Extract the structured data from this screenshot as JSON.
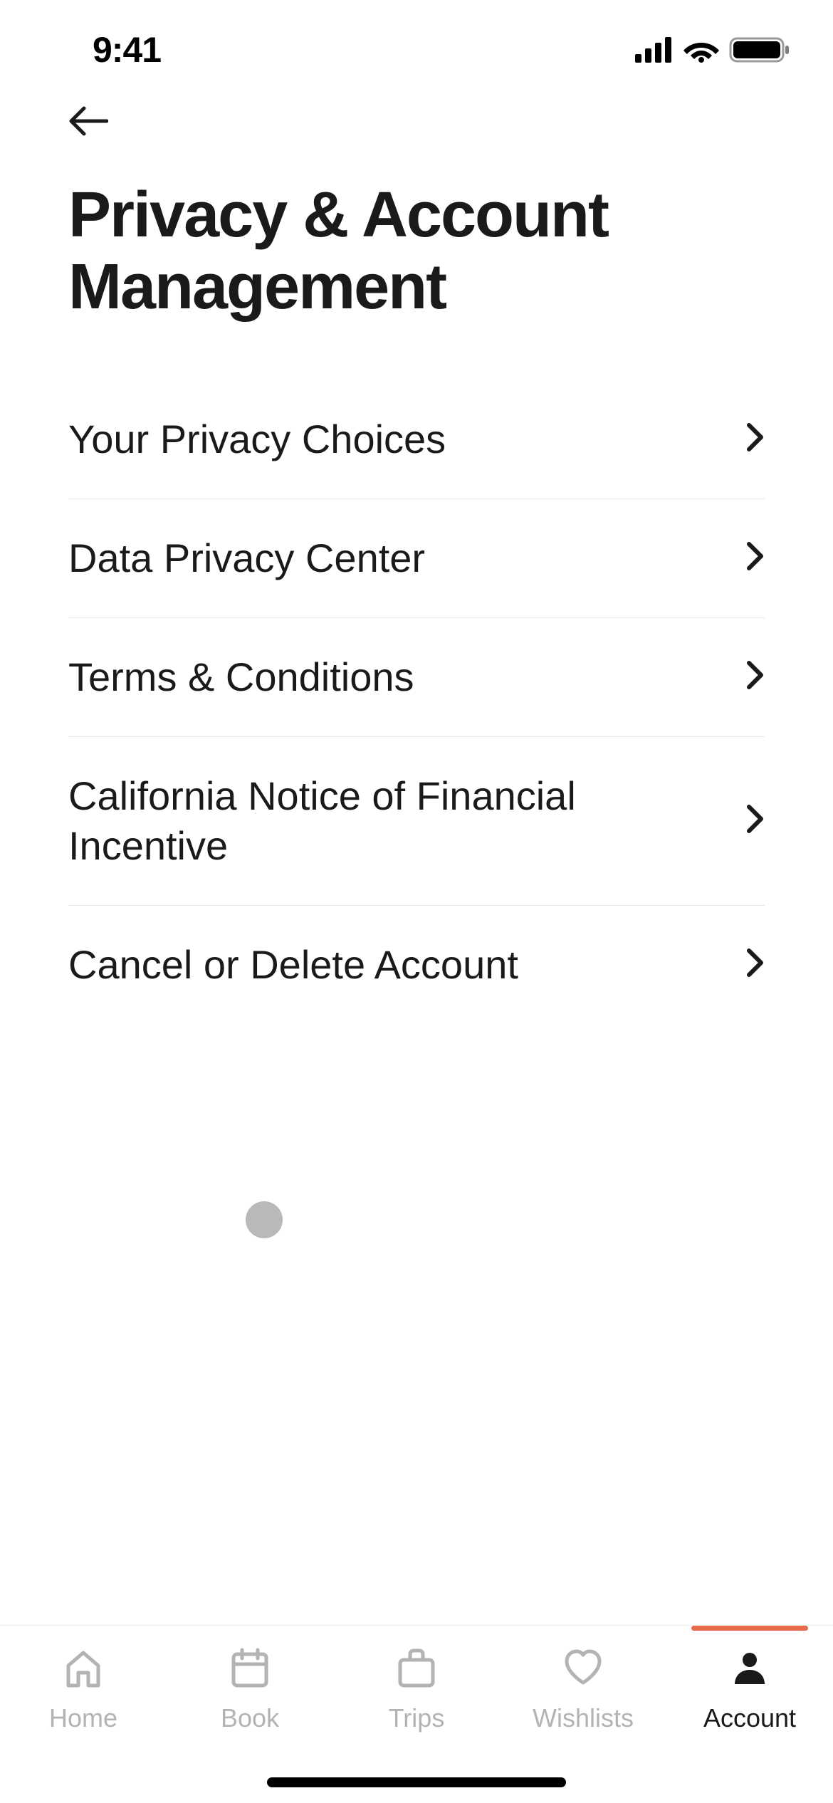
{
  "statusBar": {
    "time": "9:41"
  },
  "page": {
    "title": "Privacy & Account Management"
  },
  "menu": {
    "items": [
      {
        "label": "Your Privacy Choices"
      },
      {
        "label": "Data Privacy Center"
      },
      {
        "label": "Terms & Conditions"
      },
      {
        "label": "California Notice of Financial Incentive"
      },
      {
        "label": "Cancel or Delete Account"
      }
    ]
  },
  "tabs": {
    "items": [
      {
        "label": "Home",
        "active": false
      },
      {
        "label": "Book",
        "active": false
      },
      {
        "label": "Trips",
        "active": false
      },
      {
        "label": "Wishlists",
        "active": false
      },
      {
        "label": "Account",
        "active": true
      }
    ]
  }
}
